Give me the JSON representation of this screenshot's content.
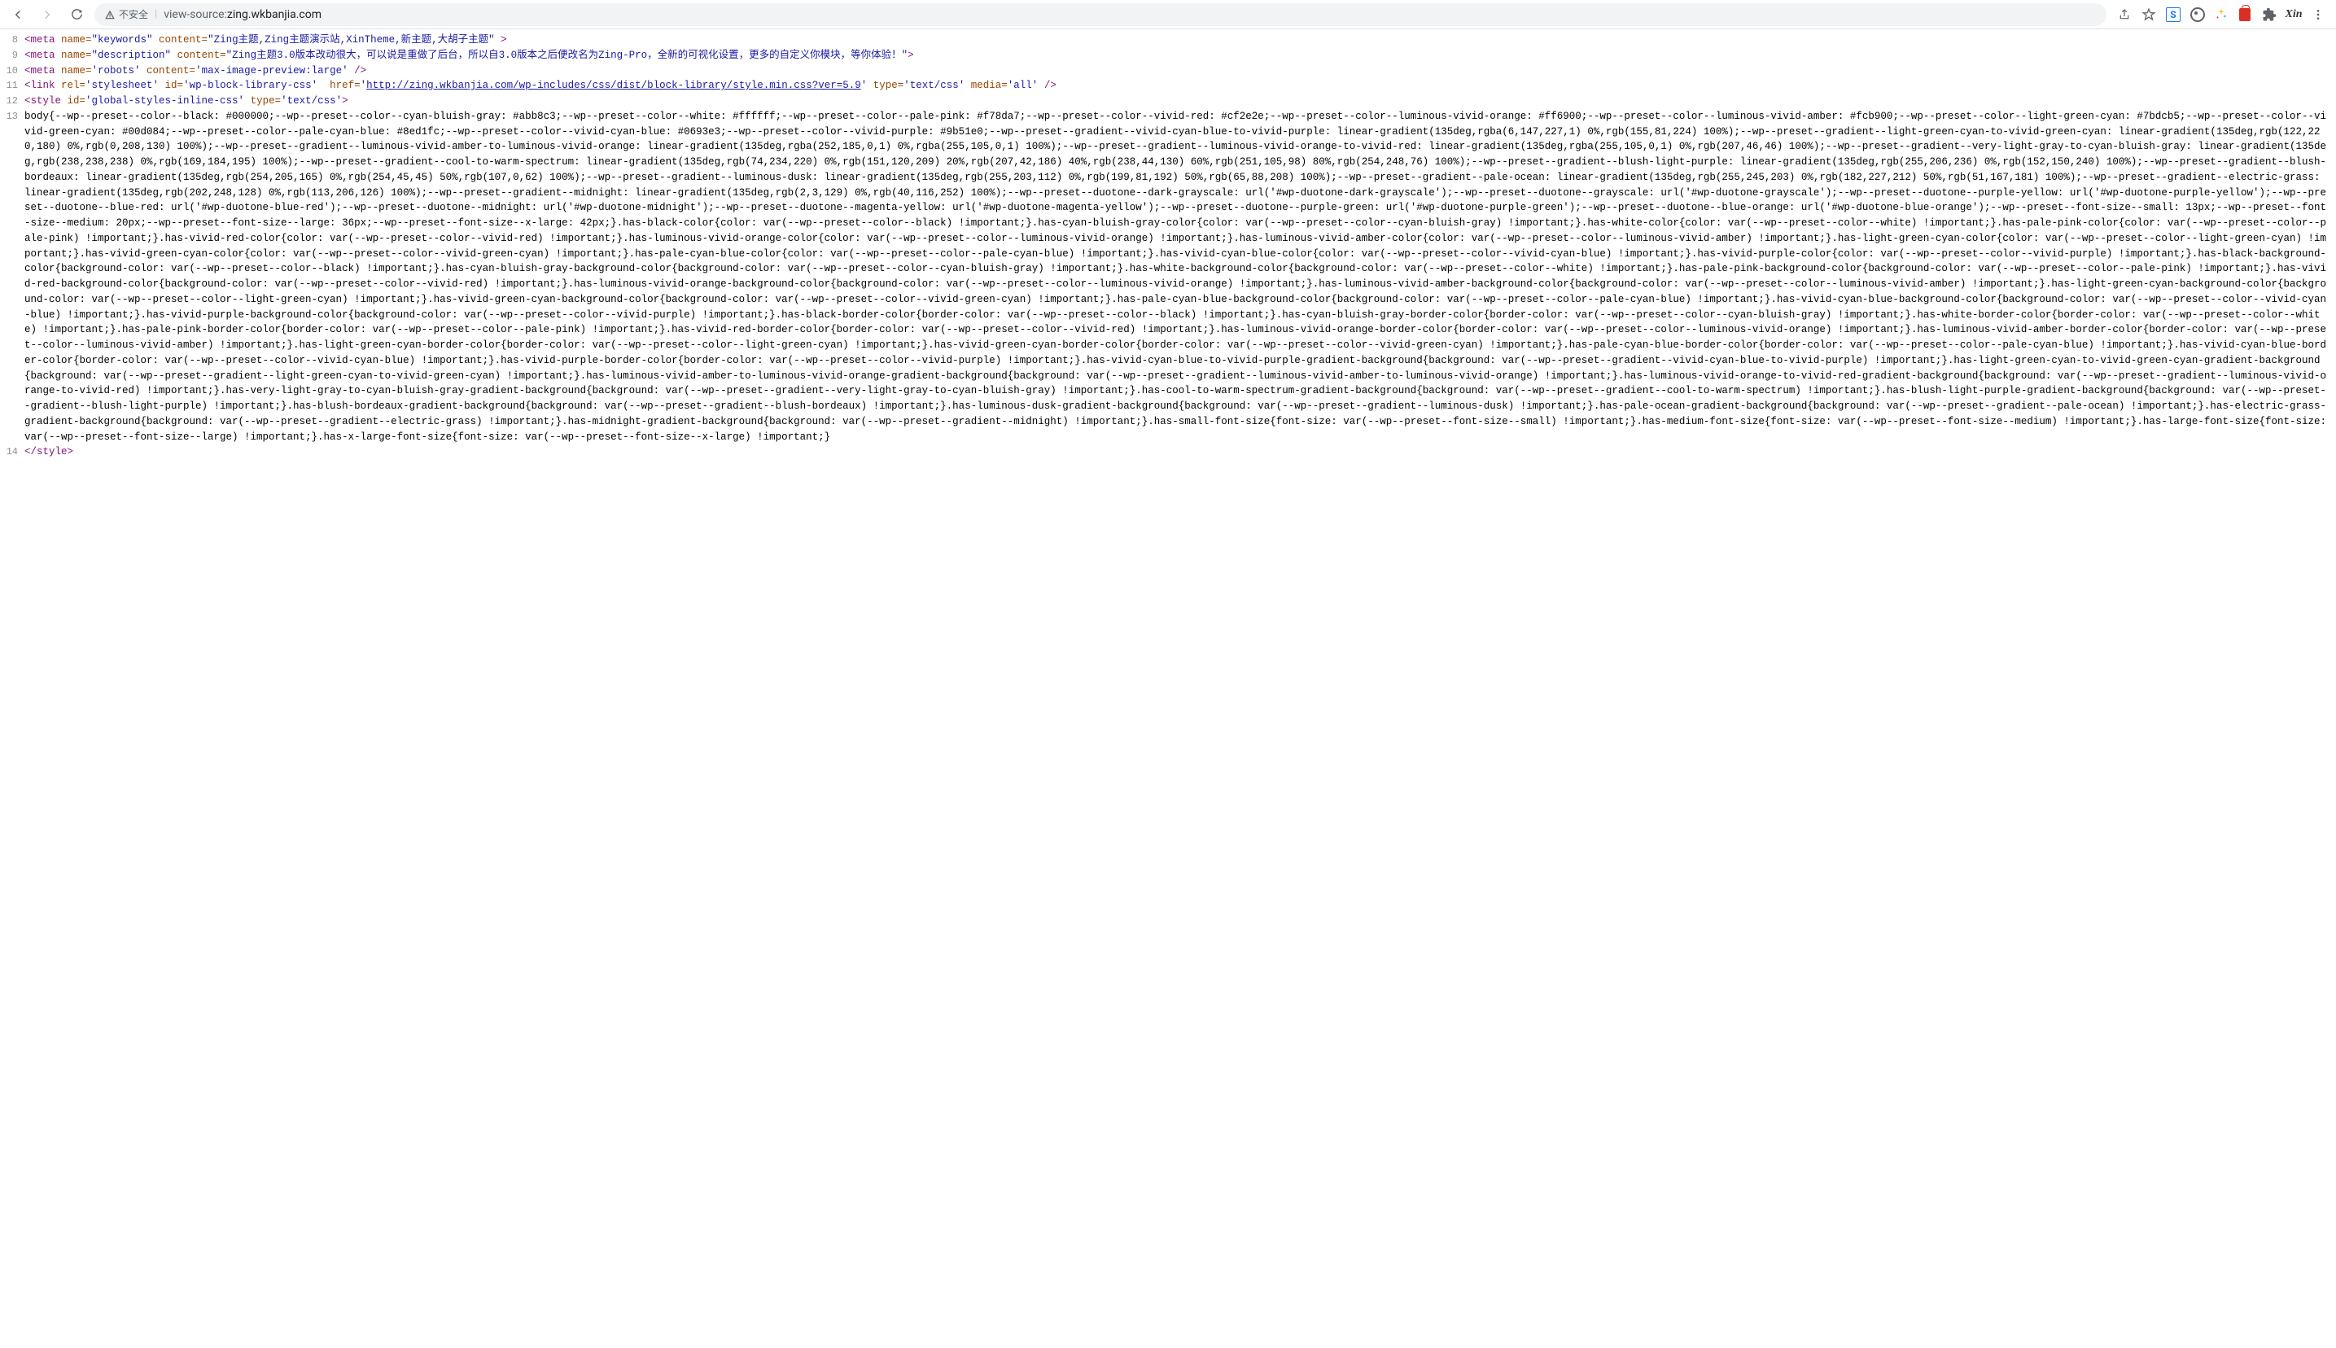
{
  "toolbar": {
    "secure_label": "不安全",
    "url_prefix": "view-source:",
    "url_host": "zing.wkbanjia.com",
    "ext_s": "S",
    "ext_xin": "Xin"
  },
  "lines": {
    "l8": {
      "num": "8"
    },
    "l9": {
      "num": "9"
    },
    "l10": {
      "num": "10"
    },
    "l11": {
      "num": "11"
    },
    "l12": {
      "num": "12"
    },
    "l13": {
      "num": "13"
    },
    "l14": {
      "num": "14"
    }
  },
  "src": {
    "l8_tag_open": "<meta",
    "l8_attr1": " name=",
    "l8_val1": "\"keywords\"",
    "l8_attr2": " content=",
    "l8_val2": "\"Zing主题,Zing主题演示站,XinTheme,新主题,大胡子主题\"",
    "l8_close": " >",
    "l9_tag_open": "<meta",
    "l9_attr1": " name=",
    "l9_val1": "\"description\"",
    "l9_attr2": " content=",
    "l9_val2": "\"Zing主题3.0版本改动很大，可以说是重做了后台，所以自3.0版本之后便改名为Zing-Pro，全新的可视化设置，更多的自定义你模块，等你体验！\"",
    "l9_close": ">",
    "l10_tag_open": "<meta",
    "l10_attr1": " name=",
    "l10_val1": "'robots'",
    "l10_attr2": " content=",
    "l10_val2": "'max-image-preview:large'",
    "l10_close": " />",
    "l11_tag_open": "<link",
    "l11_attr1": " rel=",
    "l11_val1": "'stylesheet'",
    "l11_attr2": " id=",
    "l11_val2": "'wp-block-library-css'",
    "l11_attr3": "  href=",
    "l11_val3_open": "'",
    "l11_link": "http://zing.wkbanjia.com/wp-includes/css/dist/block-library/style.min.css?ver=5.9",
    "l11_val3_close": "'",
    "l11_attr4": " type=",
    "l11_val4": "'text/css'",
    "l11_attr5": " media=",
    "l11_val5": "'all'",
    "l11_close": " />",
    "l12_tag_open": "<style",
    "l12_attr1": " id=",
    "l12_val1": "'global-styles-inline-css'",
    "l12_attr2": " type=",
    "l12_val2": "'text/css'",
    "l12_close": ">",
    "l13_css": "body{--wp--preset--color--black: #000000;--wp--preset--color--cyan-bluish-gray: #abb8c3;--wp--preset--color--white: #ffffff;--wp--preset--color--pale-pink: #f78da7;--wp--preset--color--vivid-red: #cf2e2e;--wp--preset--color--luminous-vivid-orange: #ff6900;--wp--preset--color--luminous-vivid-amber: #fcb900;--wp--preset--color--light-green-cyan: #7bdcb5;--wp--preset--color--vivid-green-cyan: #00d084;--wp--preset--color--pale-cyan-blue: #8ed1fc;--wp--preset--color--vivid-cyan-blue: #0693e3;--wp--preset--color--vivid-purple: #9b51e0;--wp--preset--gradient--vivid-cyan-blue-to-vivid-purple: linear-gradient(135deg,rgba(6,147,227,1) 0%,rgb(155,81,224) 100%);--wp--preset--gradient--light-green-cyan-to-vivid-green-cyan: linear-gradient(135deg,rgb(122,220,180) 0%,rgb(0,208,130) 100%);--wp--preset--gradient--luminous-vivid-amber-to-luminous-vivid-orange: linear-gradient(135deg,rgba(252,185,0,1) 0%,rgba(255,105,0,1) 100%);--wp--preset--gradient--luminous-vivid-orange-to-vivid-red: linear-gradient(135deg,rgba(255,105,0,1) 0%,rgb(207,46,46) 100%);--wp--preset--gradient--very-light-gray-to-cyan-bluish-gray: linear-gradient(135deg,rgb(238,238,238) 0%,rgb(169,184,195) 100%);--wp--preset--gradient--cool-to-warm-spectrum: linear-gradient(135deg,rgb(74,234,220) 0%,rgb(151,120,209) 20%,rgb(207,42,186) 40%,rgb(238,44,130) 60%,rgb(251,105,98) 80%,rgb(254,248,76) 100%);--wp--preset--gradient--blush-light-purple: linear-gradient(135deg,rgb(255,206,236) 0%,rgb(152,150,240) 100%);--wp--preset--gradient--blush-bordeaux: linear-gradient(135deg,rgb(254,205,165) 0%,rgb(254,45,45) 50%,rgb(107,0,62) 100%);--wp--preset--gradient--luminous-dusk: linear-gradient(135deg,rgb(255,203,112) 0%,rgb(199,81,192) 50%,rgb(65,88,208) 100%);--wp--preset--gradient--pale-ocean: linear-gradient(135deg,rgb(255,245,203) 0%,rgb(182,227,212) 50%,rgb(51,167,181) 100%);--wp--preset--gradient--electric-grass: linear-gradient(135deg,rgb(202,248,128) 0%,rgb(113,206,126) 100%);--wp--preset--gradient--midnight: linear-gradient(135deg,rgb(2,3,129) 0%,rgb(40,116,252) 100%);--wp--preset--duotone--dark-grayscale: url('#wp-duotone-dark-grayscale');--wp--preset--duotone--grayscale: url('#wp-duotone-grayscale');--wp--preset--duotone--purple-yellow: url('#wp-duotone-purple-yellow');--wp--preset--duotone--blue-red: url('#wp-duotone-blue-red');--wp--preset--duotone--midnight: url('#wp-duotone-midnight');--wp--preset--duotone--magenta-yellow: url('#wp-duotone-magenta-yellow');--wp--preset--duotone--purple-green: url('#wp-duotone-purple-green');--wp--preset--duotone--blue-orange: url('#wp-duotone-blue-orange');--wp--preset--font-size--small: 13px;--wp--preset--font-size--medium: 20px;--wp--preset--font-size--large: 36px;--wp--preset--font-size--x-large: 42px;}.has-black-color{color: var(--wp--preset--color--black) !important;}.has-cyan-bluish-gray-color{color: var(--wp--preset--color--cyan-bluish-gray) !important;}.has-white-color{color: var(--wp--preset--color--white) !important;}.has-pale-pink-color{color: var(--wp--preset--color--pale-pink) !important;}.has-vivid-red-color{color: var(--wp--preset--color--vivid-red) !important;}.has-luminous-vivid-orange-color{color: var(--wp--preset--color--luminous-vivid-orange) !important;}.has-luminous-vivid-amber-color{color: var(--wp--preset--color--luminous-vivid-amber) !important;}.has-light-green-cyan-color{color: var(--wp--preset--color--light-green-cyan) !important;}.has-vivid-green-cyan-color{color: var(--wp--preset--color--vivid-green-cyan) !important;}.has-pale-cyan-blue-color{color: var(--wp--preset--color--pale-cyan-blue) !important;}.has-vivid-cyan-blue-color{color: var(--wp--preset--color--vivid-cyan-blue) !important;}.has-vivid-purple-color{color: var(--wp--preset--color--vivid-purple) !important;}.has-black-background-color{background-color: var(--wp--preset--color--black) !important;}.has-cyan-bluish-gray-background-color{background-color: var(--wp--preset--color--cyan-bluish-gray) !important;}.has-white-background-color{background-color: var(--wp--preset--color--white) !important;}.has-pale-pink-background-color{background-color: var(--wp--preset--color--pale-pink) !important;}.has-vivid-red-background-color{background-color: var(--wp--preset--color--vivid-red) !important;}.has-luminous-vivid-orange-background-color{background-color: var(--wp--preset--color--luminous-vivid-orange) !important;}.has-luminous-vivid-amber-background-color{background-color: var(--wp--preset--color--luminous-vivid-amber) !important;}.has-light-green-cyan-background-color{background-color: var(--wp--preset--color--light-green-cyan) !important;}.has-vivid-green-cyan-background-color{background-color: var(--wp--preset--color--vivid-green-cyan) !important;}.has-pale-cyan-blue-background-color{background-color: var(--wp--preset--color--pale-cyan-blue) !important;}.has-vivid-cyan-blue-background-color{background-color: var(--wp--preset--color--vivid-cyan-blue) !important;}.has-vivid-purple-background-color{background-color: var(--wp--preset--color--vivid-purple) !important;}.has-black-border-color{border-color: var(--wp--preset--color--black) !important;}.has-cyan-bluish-gray-border-color{border-color: var(--wp--preset--color--cyan-bluish-gray) !important;}.has-white-border-color{border-color: var(--wp--preset--color--white) !important;}.has-pale-pink-border-color{border-color: var(--wp--preset--color--pale-pink) !important;}.has-vivid-red-border-color{border-color: var(--wp--preset--color--vivid-red) !important;}.has-luminous-vivid-orange-border-color{border-color: var(--wp--preset--color--luminous-vivid-orange) !important;}.has-luminous-vivid-amber-border-color{border-color: var(--wp--preset--color--luminous-vivid-amber) !important;}.has-light-green-cyan-border-color{border-color: var(--wp--preset--color--light-green-cyan) !important;}.has-vivid-green-cyan-border-color{border-color: var(--wp--preset--color--vivid-green-cyan) !important;}.has-pale-cyan-blue-border-color{border-color: var(--wp--preset--color--pale-cyan-blue) !important;}.has-vivid-cyan-blue-border-color{border-color: var(--wp--preset--color--vivid-cyan-blue) !important;}.has-vivid-purple-border-color{border-color: var(--wp--preset--color--vivid-purple) !important;}.has-vivid-cyan-blue-to-vivid-purple-gradient-background{background: var(--wp--preset--gradient--vivid-cyan-blue-to-vivid-purple) !important;}.has-light-green-cyan-to-vivid-green-cyan-gradient-background{background: var(--wp--preset--gradient--light-green-cyan-to-vivid-green-cyan) !important;}.has-luminous-vivid-amber-to-luminous-vivid-orange-gradient-background{background: var(--wp--preset--gradient--luminous-vivid-amber-to-luminous-vivid-orange) !important;}.has-luminous-vivid-orange-to-vivid-red-gradient-background{background: var(--wp--preset--gradient--luminous-vivid-orange-to-vivid-red) !important;}.has-very-light-gray-to-cyan-bluish-gray-gradient-background{background: var(--wp--preset--gradient--very-light-gray-to-cyan-bluish-gray) !important;}.has-cool-to-warm-spectrum-gradient-background{background: var(--wp--preset--gradient--cool-to-warm-spectrum) !important;}.has-blush-light-purple-gradient-background{background: var(--wp--preset--gradient--blush-light-purple) !important;}.has-blush-bordeaux-gradient-background{background: var(--wp--preset--gradient--blush-bordeaux) !important;}.has-luminous-dusk-gradient-background{background: var(--wp--preset--gradient--luminous-dusk) !important;}.has-pale-ocean-gradient-background{background: var(--wp--preset--gradient--pale-ocean) !important;}.has-electric-grass-gradient-background{background: var(--wp--preset--gradient--electric-grass) !important;}.has-midnight-gradient-background{background: var(--wp--preset--gradient--midnight) !important;}.has-small-font-size{font-size: var(--wp--preset--font-size--small) !important;}.has-medium-font-size{font-size: var(--wp--preset--font-size--medium) !important;}.has-large-font-size{font-size: var(--wp--preset--font-size--large) !important;}.has-x-large-font-size{font-size: var(--wp--preset--font-size--x-large) !important;}",
    "l14_close": "</style>"
  }
}
